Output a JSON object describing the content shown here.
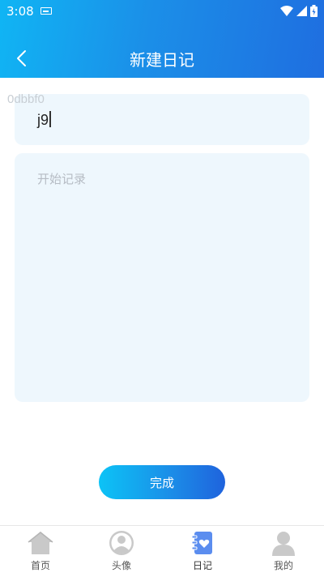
{
  "status": {
    "time": "3:08"
  },
  "header": {
    "title": "新建日记"
  },
  "debug": {
    "text": "0dbbf0"
  },
  "title_field": {
    "value": "j9"
  },
  "content_field": {
    "placeholder": "开始记录"
  },
  "actions": {
    "done_label": "完成"
  },
  "tabbar": {
    "items": [
      {
        "label": "首页",
        "icon": "home-icon",
        "active": false
      },
      {
        "label": "头像",
        "icon": "avatar-icon",
        "active": false
      },
      {
        "label": "日记",
        "icon": "diary-icon",
        "active": true
      },
      {
        "label": "我的",
        "icon": "profile-icon",
        "active": false
      }
    ]
  },
  "colors": {
    "header_start": "#10b5f4",
    "header_end": "#1f6ee0",
    "card_bg": "#eef7fd",
    "tab_icon_inactive": "#c9c9c9",
    "tab_icon_active": "#5b8def"
  }
}
